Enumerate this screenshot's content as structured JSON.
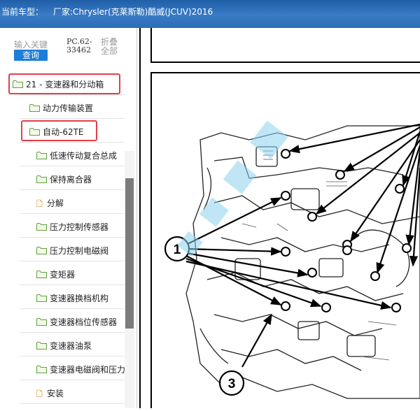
{
  "header": {
    "label": "当前车型：",
    "vehicle": "厂家:Chrysler(克莱斯勒)酷威(JCUV)2016"
  },
  "sidebar": {
    "search_placeholder": "输入关键",
    "search_button": "查询",
    "pc_code": "PC.62-33462",
    "collapse_all": "折叠全部",
    "tree": [
      {
        "label": "21 - 变速器和分动箱",
        "type": "folder"
      },
      {
        "label": "动力传输装置",
        "type": "folder"
      },
      {
        "label": "自动-62TE",
        "type": "folder"
      },
      {
        "label": "低速传动复合总成",
        "type": "folder"
      },
      {
        "label": "保持离合器",
        "type": "folder"
      },
      {
        "label": "分解",
        "type": "doc"
      },
      {
        "label": "压力控制传感器",
        "type": "folder"
      },
      {
        "label": "压力控制电磁阀",
        "type": "folder"
      },
      {
        "label": "变矩器",
        "type": "folder"
      },
      {
        "label": "变速器换档机构",
        "type": "folder"
      },
      {
        "label": "变速器档位传感器",
        "type": "folder"
      },
      {
        "label": "变速器油泵",
        "type": "folder"
      },
      {
        "label": "变速器电磁阀和压力开关",
        "type": "folder"
      },
      {
        "label": "安装",
        "type": "doc"
      }
    ]
  },
  "diagram": {
    "callouts": [
      "1",
      "3"
    ]
  },
  "colors": {
    "header": "#2d6cb5",
    "button": "#1d7fd8",
    "folder": "#7ab648",
    "highlight": "#e0404a"
  }
}
